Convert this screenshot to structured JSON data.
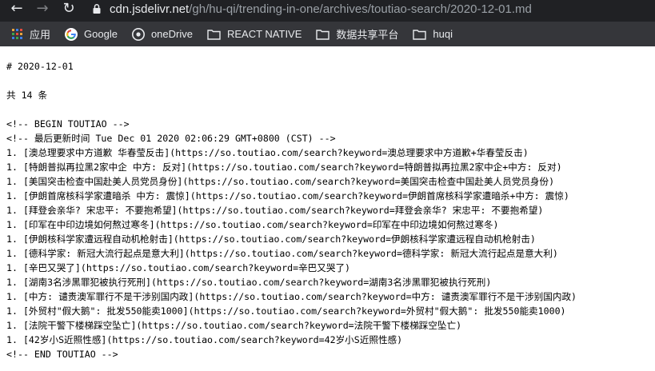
{
  "browser": {
    "url_host": "cdn.jsdelivr.net",
    "url_path": "/gh/hu-qi/trending-in-one/archives/toutiao-search/2020-12-01.md",
    "bookmarks": [
      {
        "label": "应用",
        "icon": "apps-grid-icon"
      },
      {
        "label": "Google",
        "icon": "google-icon"
      },
      {
        "label": "oneDrive",
        "icon": "onedrive-icon"
      },
      {
        "label": "REACT NATIVE",
        "icon": "folder-icon"
      },
      {
        "label": "数据共享平台",
        "icon": "folder-icon"
      },
      {
        "label": "huqi",
        "icon": "folder-icon"
      }
    ]
  },
  "document": {
    "heading": "# 2020-12-01",
    "count": "共 14 条",
    "begin_comment": "<!-- BEGIN TOUTIAO -->",
    "updated_comment": "<!-- 最后更新时间 Tue Dec 01 2020 02:06:29 GMT+0800 (CST) -->",
    "items": [
      "1. [澳总理要求中方道歉 华春莹反击](https://so.toutiao.com/search?keyword=澳总理要求中方道歉+华春莹反击)",
      "1. [特朗普拟再拉黑2家中企 中方: 反对](https://so.toutiao.com/search?keyword=特朗普拟再拉黑2家中企+中方: 反对)",
      "1. [美国突击检查中国赴美人员党员身份](https://so.toutiao.com/search?keyword=美国突击检查中国赴美人员党员身份)",
      "1. [伊朗首席核科学家遭暗杀 中方: 震惊](https://so.toutiao.com/search?keyword=伊朗首席核科学家遭暗杀+中方: 震惊)",
      "1. [拜登会亲华? 宋忠平: 不要抱希望](https://so.toutiao.com/search?keyword=拜登会亲华? 宋忠平: 不要抱希望)",
      "1. [印军在中印边境如何熬过寒冬](https://so.toutiao.com/search?keyword=印军在中印边境如何熬过寒冬)",
      "1. [伊朗核科学家遭远程自动机枪射击](https://so.toutiao.com/search?keyword=伊朗核科学家遭远程自动机枪射击)",
      "1. [德科学家: 新冠大流行起点是意大利](https://so.toutiao.com/search?keyword=德科学家: 新冠大流行起点是意大利)",
      "1. [辛巴又哭了](https://so.toutiao.com/search?keyword=辛巴又哭了)",
      "1. [湖南3名涉黑罪犯被执行死刑](https://so.toutiao.com/search?keyword=湖南3名涉黑罪犯被执行死刑)",
      "1. [中方: 谴责澳军罪行不是干涉别国内政](https://so.toutiao.com/search?keyword=中方: 谴责澳军罪行不是干涉别国内政)",
      "1. [外贸村\"假大鹅\": 批发550能卖1000](https://so.toutiao.com/search?keyword=外贸村\"假大鹅\": 批发550能卖1000)",
      "1. [法院干警下楼梯踩空坠亡](https://so.toutiao.com/search?keyword=法院干警下楼梯踩空坠亡)",
      "1. [42岁小S近照性感](https://so.toutiao.com/search?keyword=42岁小S近照性感)"
    ],
    "end_comment": "<!-- END TOUTIAO -->"
  }
}
